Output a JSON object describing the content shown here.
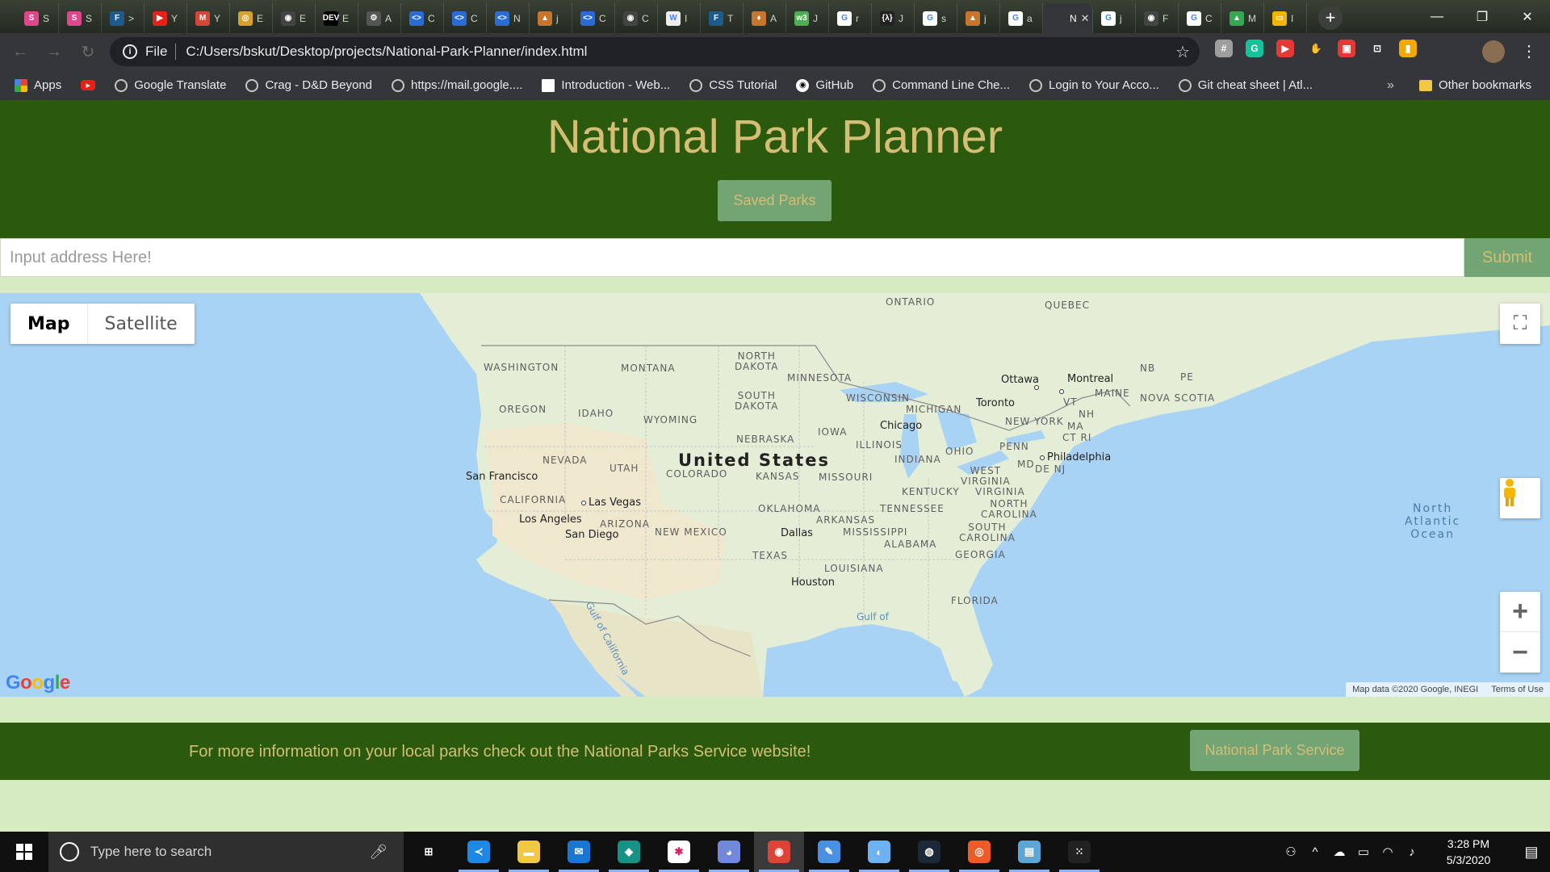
{
  "browser": {
    "tabs": [
      {
        "icon": "slack-style-icon",
        "color": "#e0468c",
        "glyph": "S",
        "text": "S"
      },
      {
        "icon": "slack-style-icon",
        "color": "#e0468c",
        "glyph": "S",
        "text": "S"
      },
      {
        "icon": "f-logo-icon",
        "color": "#1d5b8e",
        "glyph": "F",
        "text": ">"
      },
      {
        "icon": "youtube-icon",
        "color": "#e62117",
        "glyph": "▶",
        "text": "Y"
      },
      {
        "icon": "gmail-icon",
        "color": "#d44638",
        "glyph": "M",
        "text": "Y"
      },
      {
        "icon": "dnd-icon",
        "color": "#d8a12a",
        "glyph": "◎",
        "text": "E"
      },
      {
        "icon": "github-icon",
        "color": "#444444",
        "glyph": "◉",
        "text": "E"
      },
      {
        "icon": "dev-icon",
        "color": "#000000",
        "glyph": "DEV",
        "text": "E"
      },
      {
        "icon": "gear-tab-icon",
        "color": "#555555",
        "glyph": "⚙",
        "text": "A"
      },
      {
        "icon": "code-icon",
        "color": "#2b6cd4",
        "glyph": "<>",
        "text": "C"
      },
      {
        "icon": "code-icon",
        "color": "#2b6cd4",
        "glyph": "<>",
        "text": "C"
      },
      {
        "icon": "code-icon",
        "color": "#2b6cd4",
        "glyph": "<>",
        "text": "N"
      },
      {
        "icon": "flame-icon",
        "color": "#c8762c",
        "glyph": "▲",
        "text": "j"
      },
      {
        "icon": "code-icon",
        "color": "#2b6cd4",
        "glyph": "<>",
        "text": "C"
      },
      {
        "icon": "github-icon",
        "color": "#444444",
        "glyph": "◉",
        "text": "C"
      },
      {
        "icon": "wikipedia-icon",
        "color": "#eeeeee",
        "glyph": "W",
        "text": "I"
      },
      {
        "icon": "f-logo-icon",
        "color": "#1d5b8e",
        "glyph": "F",
        "text": "T"
      },
      {
        "icon": "brave-icon",
        "color": "#c8762c",
        "glyph": "♦",
        "text": "A"
      },
      {
        "icon": "w3-icon",
        "color": "#4caf50",
        "glyph": "w3",
        "text": "J"
      },
      {
        "icon": "google-icon",
        "color": "#ffffff",
        "glyph": "G",
        "text": "r"
      },
      {
        "icon": "codewars-icon",
        "color": "#222222",
        "glyph": "{λ}",
        "text": "J"
      },
      {
        "icon": "google-icon",
        "color": "#ffffff",
        "glyph": "G",
        "text": "s"
      },
      {
        "icon": "flame-icon",
        "color": "#c8762c",
        "glyph": "▲",
        "text": "j"
      },
      {
        "icon": "google-icon",
        "color": "#ffffff",
        "glyph": "G",
        "text": "a"
      },
      {
        "icon": "page-icon",
        "color": "#35363a",
        "glyph": "",
        "text": "N",
        "active": true
      },
      {
        "icon": "google-icon",
        "color": "#ffffff",
        "glyph": "G",
        "text": "j"
      },
      {
        "icon": "github-icon",
        "color": "#444444",
        "glyph": "◉",
        "text": "F"
      },
      {
        "icon": "google-icon",
        "color": "#ffffff",
        "glyph": "G",
        "text": "C"
      },
      {
        "icon": "drive-icon",
        "color": "#34a853",
        "glyph": "▲",
        "text": "M"
      },
      {
        "icon": "slides-icon",
        "color": "#f4b400",
        "glyph": "▭",
        "text": "I"
      }
    ],
    "window_controls": {
      "minimize": "—",
      "restore": "❐",
      "close": "✕"
    },
    "omnibox": {
      "scheme_label": "File",
      "url": "C:/Users/bskut/Desktop/projects/National-Park-Planner/index.html"
    },
    "extensions": [
      {
        "name": "extension-hash-icon",
        "color": "#9e9e9e",
        "glyph": "#"
      },
      {
        "name": "grammarly-icon",
        "color": "#15c39a",
        "glyph": "G"
      },
      {
        "name": "screen-recorder-icon",
        "color": "#e53935",
        "glyph": "▶"
      },
      {
        "name": "hand-icon",
        "color": "#35363a",
        "glyph": "✋"
      },
      {
        "name": "gift-icon",
        "color": "#e53935",
        "glyph": "▣"
      },
      {
        "name": "resize-icon",
        "color": "#35363a",
        "glyph": "⊡"
      },
      {
        "name": "chart-extension-icon",
        "color": "#f2a900",
        "glyph": "▮"
      }
    ],
    "bookmarks": [
      {
        "name": "bookmark-apps",
        "label": "Apps",
        "icon": "apps-grid-icon"
      },
      {
        "name": "bookmark-youtube",
        "label": "",
        "icon": "youtube-icon"
      },
      {
        "name": "bookmark-google-translate",
        "label": "Google Translate",
        "icon": "globe-icon"
      },
      {
        "name": "bookmark-crag",
        "label": "Crag - D&D Beyond",
        "icon": "globe-icon"
      },
      {
        "name": "bookmark-mail-google",
        "label": "https://mail.google....",
        "icon": "globe-icon"
      },
      {
        "name": "bookmark-intro-web",
        "label": "Introduction - Web...",
        "icon": "page-icon"
      },
      {
        "name": "bookmark-css-tutorial",
        "label": "CSS Tutorial",
        "icon": "globe-icon"
      },
      {
        "name": "bookmark-github",
        "label": "GitHub",
        "icon": "github-icon"
      },
      {
        "name": "bookmark-command-line",
        "label": "Command Line Che...",
        "icon": "globe-icon"
      },
      {
        "name": "bookmark-login",
        "label": "Login to Your Acco...",
        "icon": "globe-icon"
      },
      {
        "name": "bookmark-git-cheat",
        "label": "Git cheat sheet | Atl...",
        "icon": "globe-icon"
      }
    ],
    "bookmarks_overflow": "»",
    "other_bookmarks": "Other bookmarks"
  },
  "site": {
    "title": "National Park Planner",
    "saved_parks_label": "Saved Parks",
    "address_placeholder": "Input address Here!",
    "submit_label": "Submit",
    "footer_text": "For more information on your local parks check out the National Parks Service website!",
    "nps_button_label": "National Park Service"
  },
  "map": {
    "type_map": "Map",
    "type_satellite": "Satellite",
    "fullscreen_glyph": "⛶",
    "zoom_in": "+",
    "zoom_out": "−",
    "logo": "Google",
    "attribution": "Map data ©2020 Google, INEGI",
    "terms": "Terms of Use",
    "country": "United States",
    "ocean": [
      "North",
      "Atlantic",
      "Ocean"
    ],
    "gulf_california": "Gulf of California",
    "gulf_mexico": "Gulf of",
    "regions": [
      "ONTARIO",
      "QUEBEC",
      "WASHINGTON",
      "MONTANA",
      "NORTH DAKOTA",
      "MINNESOTA",
      "NB",
      "PE",
      "OREGON",
      "IDAHO",
      "SOUTH DAKOTA",
      "WISCONSIN",
      "MICHIGAN",
      "MAINE",
      "NOVA SCOTIA",
      "WYOMING",
      "VT",
      "NH",
      "NEW YORK",
      "MA",
      "CT",
      "RI",
      "IOWA",
      "NEBRASKA",
      "ILLINOIS",
      "OHIO",
      "PENN",
      "NEVADA",
      "UTAH",
      "COLORADO",
      "KANSAS",
      "MISSOURI",
      "INDIANA",
      "WEST VIRGINIA",
      "MD",
      "DE",
      "NJ",
      "KENTUCKY",
      "VIRGINIA",
      "CALIFORNIA",
      "TENNESSEE",
      "NORTH CAROLINA",
      "OKLAHOMA",
      "ARKANSAS",
      "ARIZONA",
      "NEW MEXICO",
      "MISSISSIPPI",
      "SOUTH CAROLINA",
      "ALABAMA",
      "GEORGIA",
      "TEXAS",
      "LOUISIANA",
      "FLORIDA"
    ],
    "cities": [
      "Ottawa",
      "Montreal",
      "Toronto",
      "Chicago",
      "Philadelphia",
      "San Francisco",
      "Las Vegas",
      "Los Angeles",
      "San Diego",
      "Dallas",
      "Houston"
    ]
  },
  "taskbar": {
    "search_placeholder": "Type here to search",
    "apps": [
      {
        "name": "task-view-icon",
        "color": "#101010",
        "glyph": "⊞"
      },
      {
        "name": "vscode-icon",
        "color": "#1e88e5",
        "glyph": "≺"
      },
      {
        "name": "file-explorer-icon",
        "color": "#f2c744",
        "glyph": "▬"
      },
      {
        "name": "mail-icon",
        "color": "#1976d2",
        "glyph": "✉"
      },
      {
        "name": "gitkraken-icon",
        "color": "#179287",
        "glyph": "◆"
      },
      {
        "name": "slack-icon",
        "color": "#ffffff",
        "glyph": "✱"
      },
      {
        "name": "discord-icon",
        "color": "#7289da",
        "glyph": "◕"
      },
      {
        "name": "chrome-icon",
        "color": "#db4437",
        "glyph": "◉"
      },
      {
        "name": "paint-icon",
        "color": "#4a90e2",
        "glyph": "✎"
      },
      {
        "name": "palette-icon",
        "color": "#6db3f2",
        "glyph": "◐"
      },
      {
        "name": "steam-icon",
        "color": "#1b2838",
        "glyph": "◍"
      },
      {
        "name": "postman-icon",
        "color": "#ef5b25",
        "glyph": "◎"
      },
      {
        "name": "notepad-icon",
        "color": "#5ba6d6",
        "glyph": "▤"
      },
      {
        "name": "dots-app-icon",
        "color": "#222222",
        "glyph": "⁙"
      }
    ],
    "time": "3:28 PM",
    "date": "5/3/2020",
    "tray": {
      "people": "⚇",
      "chevron": "^",
      "cloud": "☁",
      "battery": "▭",
      "wifi": "◠",
      "volume": "♪",
      "notifications": "▤"
    }
  }
}
